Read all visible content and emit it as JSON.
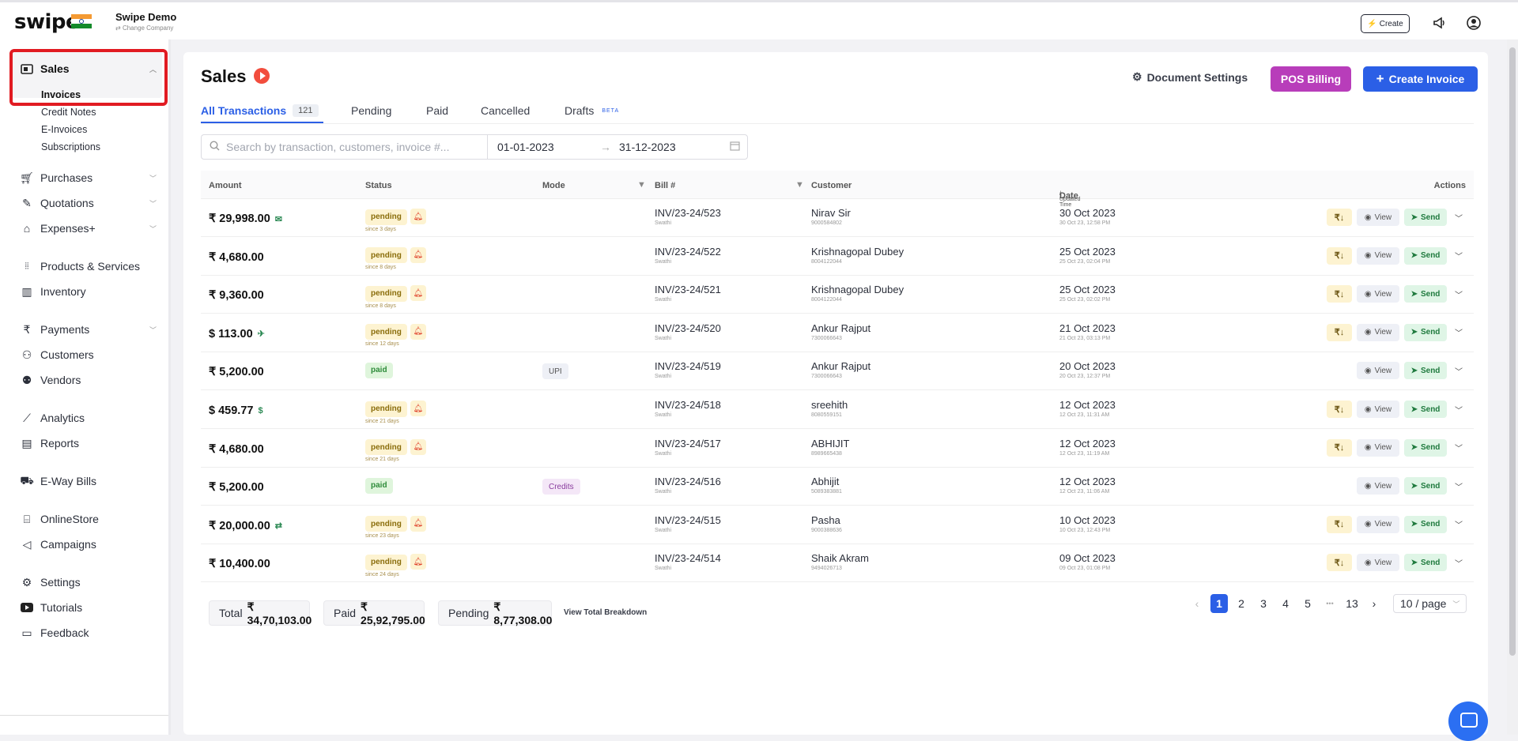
{
  "brand": {
    "logo": "swipe",
    "company_name": "Swipe Demo",
    "change_company": "Change Company"
  },
  "topbar": {
    "create_label": "Create"
  },
  "sidebar": {
    "sales": {
      "label": "Sales",
      "subitems": [
        "Invoices",
        "Credit Notes",
        "E-Invoices",
        "Subscriptions"
      ]
    },
    "items": [
      {
        "label": "Purchases",
        "icon": "cart-icon",
        "expandable": true
      },
      {
        "label": "Quotations",
        "icon": "pencil-icon",
        "expandable": true
      },
      {
        "label": "Expenses+",
        "icon": "tag-icon",
        "expandable": true
      },
      {
        "label": "Products & Services",
        "icon": "barcode-icon",
        "expandable": false
      },
      {
        "label": "Inventory",
        "icon": "warehouse-icon",
        "expandable": false
      },
      {
        "label": "Payments",
        "icon": "rupee-icon",
        "expandable": true
      },
      {
        "label": "Customers",
        "icon": "user-icon",
        "expandable": false
      },
      {
        "label": "Vendors",
        "icon": "users-icon",
        "expandable": false
      },
      {
        "label": "Analytics",
        "icon": "chart-icon",
        "expandable": false
      },
      {
        "label": "Reports",
        "icon": "report-icon",
        "expandable": false
      },
      {
        "label": "E-Way Bills",
        "icon": "truck-icon",
        "expandable": false
      },
      {
        "label": "OnlineStore",
        "icon": "store-icon",
        "expandable": false
      },
      {
        "label": "Campaigns",
        "icon": "megaphone-icon",
        "expandable": false
      },
      {
        "label": "Settings",
        "icon": "gear-icon",
        "expandable": false
      },
      {
        "label": "Tutorials",
        "icon": "youtube-icon",
        "expandable": false
      },
      {
        "label": "Feedback",
        "icon": "chat-icon",
        "expandable": false
      }
    ]
  },
  "page": {
    "title": "Sales",
    "document_settings": "Document Settings",
    "pos_billing": "POS Billing",
    "create_invoice": "Create Invoice",
    "tabs": [
      {
        "label": "All Transactions",
        "count": "121"
      },
      {
        "label": "Pending"
      },
      {
        "label": "Paid"
      },
      {
        "label": "Cancelled"
      },
      {
        "label": "Drafts",
        "badge": "BETA"
      }
    ],
    "search_placeholder": "Search by transaction, customers, invoice #...",
    "date_from": "01-01-2023",
    "date_to": "31-12-2023"
  },
  "table": {
    "headers": {
      "amount": "Amount",
      "status": "Status",
      "mode": "Mode",
      "bill": "Bill #",
      "customer": "Customer",
      "date": "Date",
      "date_sub": "/ Updated Time",
      "actions": "Actions"
    },
    "rows": [
      {
        "amount": "₹ 29,998.00",
        "amount_icon": "✉",
        "status": "pending",
        "since": "since 3 days",
        "mode": "",
        "bill": "INV/23-24/523",
        "bill_sub": "Swathi",
        "customer": "Nirav Sir",
        "phone": "9000584802",
        "date": "30 Oct 2023",
        "updated": "30 Oct 23, 12:58 PM",
        "show_rs": true
      },
      {
        "amount": "₹ 4,680.00",
        "amount_icon": "",
        "status": "pending",
        "since": "since 8 days",
        "mode": "",
        "bill": "INV/23-24/522",
        "bill_sub": "Swathi",
        "customer": "Krishnagopal Dubey",
        "phone": "8004122044",
        "date": "25 Oct 2023",
        "updated": "25 Oct 23, 02:04 PM",
        "show_rs": true
      },
      {
        "amount": "₹ 9,360.00",
        "amount_icon": "",
        "status": "pending",
        "since": "since 8 days",
        "mode": "",
        "bill": "INV/23-24/521",
        "bill_sub": "Swathi",
        "customer": "Krishnagopal Dubey",
        "phone": "8004122044",
        "date": "25 Oct 2023",
        "updated": "25 Oct 23, 02:02 PM",
        "show_rs": true
      },
      {
        "amount": "$ 113.00",
        "amount_icon": "✈",
        "status": "pending",
        "since": "since 12 days",
        "mode": "",
        "bill": "INV/23-24/520",
        "bill_sub": "Swathi",
        "customer": "Ankur Rajput",
        "phone": "7300066643",
        "date": "21 Oct 2023",
        "updated": "21 Oct 23, 03:13 PM",
        "show_rs": true
      },
      {
        "amount": "₹ 5,200.00",
        "amount_icon": "",
        "status": "paid",
        "since": "",
        "mode": "UPI",
        "bill": "INV/23-24/519",
        "bill_sub": "Swathi",
        "customer": "Ankur Rajput",
        "phone": "7300066643",
        "date": "20 Oct 2023",
        "updated": "20 Oct 23, 12:37 PM",
        "show_rs": false
      },
      {
        "amount": "$ 459.77",
        "amount_icon": "$",
        "status": "pending",
        "since": "since 21 days",
        "mode": "",
        "bill": "INV/23-24/518",
        "bill_sub": "Swathi",
        "customer": "sreehith",
        "phone": "8080559151",
        "date": "12 Oct 2023",
        "updated": "12 Oct 23, 11:31 AM",
        "show_rs": true
      },
      {
        "amount": "₹ 4,680.00",
        "amount_icon": "",
        "status": "pending",
        "since": "since 21 days",
        "mode": "",
        "bill": "INV/23-24/517",
        "bill_sub": "Swathi",
        "customer": "ABHIJIT",
        "phone": "8989665438",
        "date": "12 Oct 2023",
        "updated": "12 Oct 23, 11:19 AM",
        "show_rs": true
      },
      {
        "amount": "₹ 5,200.00",
        "amount_icon": "",
        "status": "paid",
        "since": "",
        "mode": "Credits",
        "bill": "INV/23-24/516",
        "bill_sub": "Swathi",
        "customer": "Abhijit",
        "phone": "5089383881",
        "date": "12 Oct 2023",
        "updated": "12 Oct 23, 11:06 AM",
        "show_rs": false
      },
      {
        "amount": "₹ 20,000.00",
        "amount_icon": "⇄",
        "status": "pending",
        "since": "since 23 days",
        "mode": "",
        "bill": "INV/23-24/515",
        "bill_sub": "Swathi",
        "customer": "Pasha",
        "phone": "9000388636",
        "date": "10 Oct 2023",
        "updated": "10 Oct 23, 12:43 PM",
        "show_rs": true
      },
      {
        "amount": "₹ 10,400.00",
        "amount_icon": "",
        "status": "pending",
        "since": "since 24 days",
        "mode": "",
        "bill": "INV/23-24/514",
        "bill_sub": "Swathi",
        "customer": "Shaik Akram",
        "phone": "9494026713",
        "date": "09 Oct 2023",
        "updated": "09 Oct 23, 01:08 PM",
        "show_rs": true
      }
    ],
    "row_actions": {
      "rs": "₹↓",
      "view": "View",
      "send": "Send"
    }
  },
  "totals": {
    "total_label": "Total",
    "total_value": "₹ 34,70,103.00",
    "paid_label": "Paid",
    "paid_value": "₹ 25,92,795.00",
    "pending_label": "Pending",
    "pending_value": "₹ 8,77,308.00",
    "breakdown": "View Total Breakdown"
  },
  "pagination": {
    "current": "1",
    "pages": [
      "1",
      "2",
      "3",
      "4",
      "5"
    ],
    "ellipsis": "•••",
    "last": "13",
    "page_size": "10 / page"
  },
  "colors": {
    "primary": "#2b5fe6",
    "pos": "#b83dba",
    "highlight": "#e11b22",
    "pending_bg": "#fdf3d1",
    "paid_bg": "#dff5dc"
  }
}
